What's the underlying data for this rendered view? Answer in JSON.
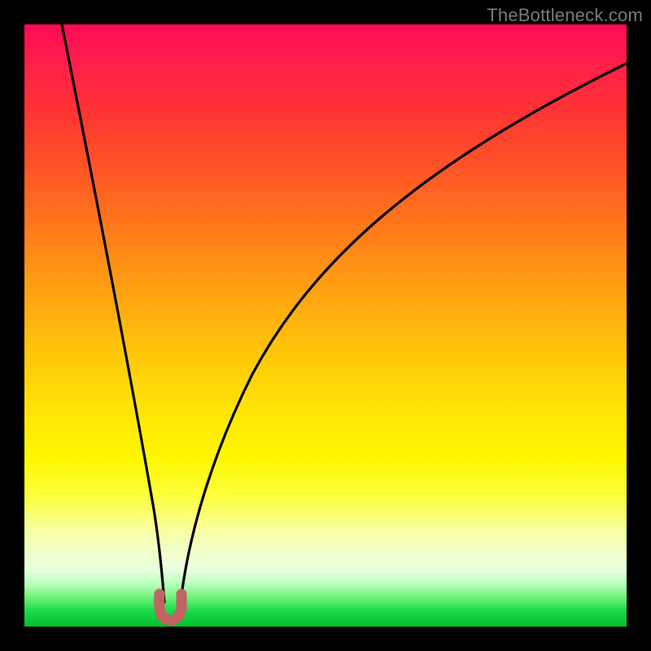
{
  "watermark": {
    "text": "TheBottleneck.com"
  },
  "chart_data": {
    "type": "line",
    "title": "",
    "xlabel": "",
    "ylabel": "",
    "xlim": [
      0,
      1
    ],
    "ylim": [
      0,
      1
    ],
    "series": [
      {
        "name": "left-branch",
        "x": [
          0.062,
          0.084,
          0.106,
          0.128,
          0.15,
          0.172,
          0.193,
          0.211,
          0.222,
          0.23
        ],
        "y": [
          1.0,
          0.885,
          0.77,
          0.655,
          0.54,
          0.42,
          0.295,
          0.17,
          0.09,
          0.04
        ]
      },
      {
        "name": "right-branch",
        "x": [
          0.26,
          0.275,
          0.3,
          0.34,
          0.4,
          0.48,
          0.58,
          0.7,
          0.84,
          1.0
        ],
        "y": [
          0.04,
          0.105,
          0.21,
          0.34,
          0.48,
          0.61,
          0.72,
          0.81,
          0.88,
          0.935
        ]
      },
      {
        "name": "valley-marker",
        "x": [
          0.225,
          0.224,
          0.227,
          0.234,
          0.244,
          0.253,
          0.259,
          0.261,
          0.26
        ],
        "y": [
          0.053,
          0.035,
          0.02,
          0.012,
          0.012,
          0.02,
          0.035,
          0.05,
          0.053
        ]
      }
    ],
    "colors": {
      "curve": "#000000",
      "valley_marker": "#c06464",
      "gradient_top": "#ff0a55",
      "gradient_bottom": "#00c02a"
    }
  }
}
